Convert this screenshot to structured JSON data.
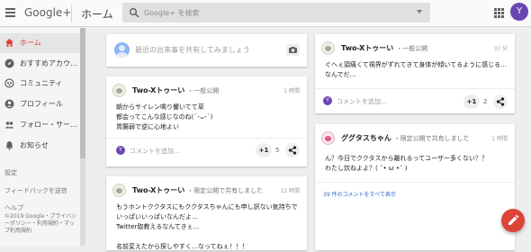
{
  "header": {
    "brand": "Google+",
    "page_name": "ホーム",
    "search_placeholder": "Google+ を検索",
    "user_initial": "Y",
    "accent_color": "#db4437"
  },
  "sidebar": {
    "items": [
      {
        "label": "ホーム",
        "icon": "home-icon",
        "active": true
      },
      {
        "label": "おすすめアカウ…",
        "icon": "compass-icon",
        "active": false
      },
      {
        "label": "コミュニティ",
        "icon": "community-icon",
        "active": false
      },
      {
        "label": "プロフィール",
        "icon": "profile-icon",
        "active": false
      },
      {
        "label": "フォロー・サー…",
        "icon": "people-icon",
        "active": false
      },
      {
        "label": "お知らせ",
        "icon": "bell-icon",
        "active": false
      }
    ],
    "settings": "設定",
    "feedback": "フィードバックを送信",
    "help": "ヘルプ",
    "legal": "©2019 Google・プライバシーポリシー・利用規約・マップ利用規約"
  },
  "share_box": {
    "prompt": "最近の出来事を共有してみましょう"
  },
  "posts": [
    {
      "author": "Two-Xトゥーい",
      "visibility": "一般公開",
      "time": "1 時間",
      "body": "朝からサイレン鳴り響いてて草\n都会ってこんな感じなのね(´･ᴗ･`)\n胃腸弱で逆に心地よい",
      "comment_placeholder": "コメントを追加...",
      "plus_label": "+1",
      "plus_count": "5"
    },
    {
      "author": "Two-Xトゥーい",
      "visibility": "限定公開で共有しました",
      "time": "12 時間",
      "body": "もうホントククタスにもククタスちゃんにも申し訳ない気持ちでいっぱいいっぱいなんだよ…\nTwitter取教えるなんてきぇ…\n\n名前変えたから探しやすく…なってねぇ！！！"
    },
    {
      "author": "Two-Xトゥーい",
      "visibility": "一般公開",
      "time": "37 分",
      "body": "ぐへぇ頭痛くて視界がずれてきて身体が傾いてるように感じる…なんでだ…",
      "comment_placeholder": "コメントを追加...",
      "plus_label": "+1",
      "plus_count": "2"
    },
    {
      "author": "ググタスちゃん",
      "visibility": "限定公開で共有しました",
      "time": "1 時間",
      "body": "ん？今日でククタスから離れるってユーザー多くない？？\nわたし炊ねよよ？( ˘• ω •˘ )",
      "all_comments": "39 件のコメントをすべて表示"
    }
  ]
}
